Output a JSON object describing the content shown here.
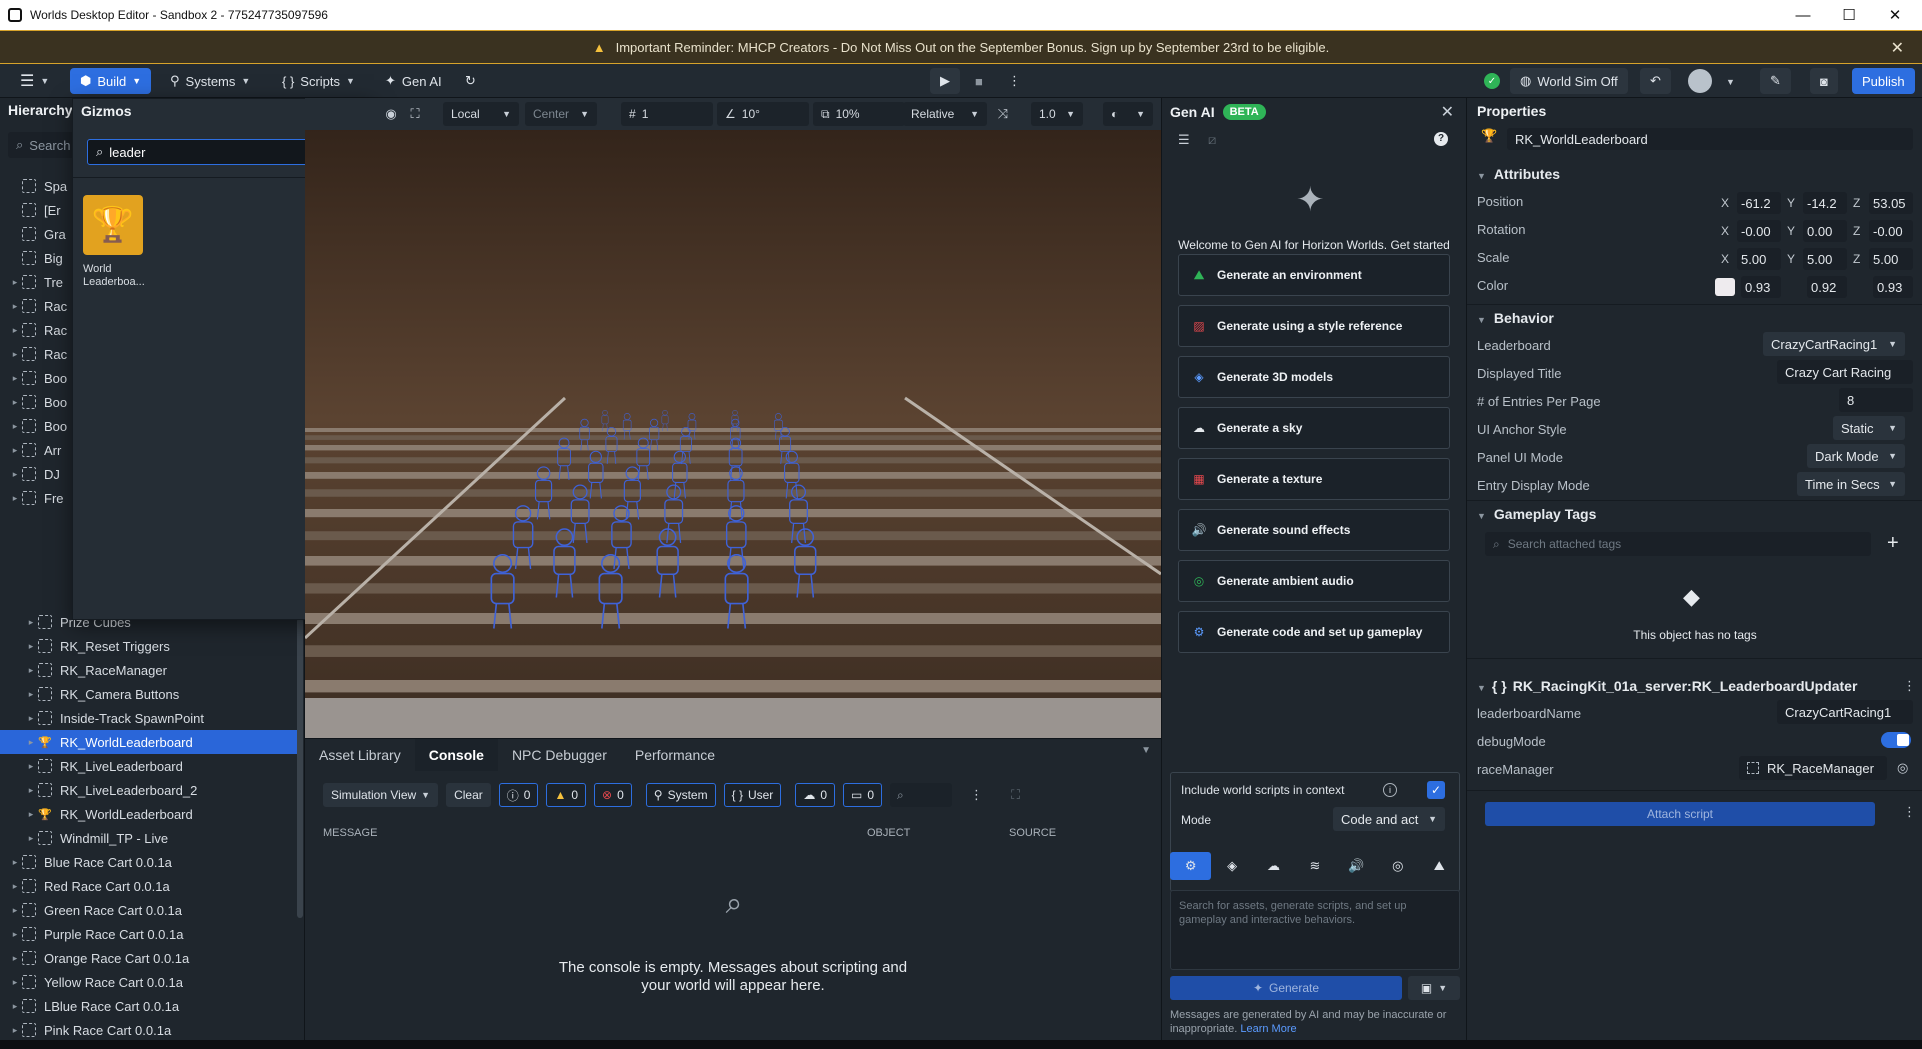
{
  "window": {
    "title": "Worlds Desktop Editor - Sandbox 2 - 775247735097596",
    "minimize": "—",
    "maximize": "☐",
    "close": "✕"
  },
  "banner": {
    "text": "Important Reminder: MHCP Creators - Do Not Miss Out on the September Bonus. Sign up by September 23rd to be eligible.",
    "close": "✕"
  },
  "toolbar": {
    "build": "Build",
    "systems": "Systems",
    "scripts": "Scripts",
    "genai": "Gen AI",
    "world_sim": "World Sim Off",
    "publish": "Publish"
  },
  "hierarchy": {
    "title": "Hierarchy",
    "search_placeholder": "Search",
    "partial_items": [
      "Spa",
      "[Er",
      "Gra",
      "Big",
      "Tre",
      "Rac",
      "Rac",
      "Rac",
      "Boo",
      "Boo",
      "Boo",
      "Arr",
      "DJ",
      "Fre"
    ],
    "items": [
      {
        "label": "Prize Cubes",
        "indent": 1
      },
      {
        "label": "RK_Reset Triggers",
        "indent": 1
      },
      {
        "label": "RK_RaceManager",
        "indent": 1
      },
      {
        "label": "RK_Camera Buttons",
        "indent": 1
      },
      {
        "label": "Inside-Track SpawnPoint",
        "indent": 1
      },
      {
        "label": "RK_WorldLeaderboard",
        "indent": 1,
        "selected": true
      },
      {
        "label": "RK_LiveLeaderboard",
        "indent": 1
      },
      {
        "label": "RK_LiveLeaderboard_2",
        "indent": 1
      },
      {
        "label": "RK_WorldLeaderboard",
        "indent": 1
      },
      {
        "label": "Windmill_TP - Live",
        "indent": 1
      },
      {
        "label": "Blue Race Cart 0.0.1a",
        "indent": 0
      },
      {
        "label": "Red Race Cart 0.0.1a",
        "indent": 0
      },
      {
        "label": "Green Race Cart 0.0.1a",
        "indent": 0
      },
      {
        "label": "Purple Race Cart 0.0.1a",
        "indent": 0
      },
      {
        "label": "Orange Race Cart 0.0.1a",
        "indent": 0
      },
      {
        "label": "Yellow Race Cart 0.0.1a",
        "indent": 0
      },
      {
        "label": "LBlue Race Cart 0.0.1a",
        "indent": 0
      },
      {
        "label": "Pink Race Cart 0.0.1a",
        "indent": 0
      }
    ]
  },
  "gizmos": {
    "title": "Gizmos",
    "search_value": "leader",
    "result_label": "World Leaderboa..."
  },
  "viewport_toolbar": {
    "space": "Local",
    "pivot": "Center",
    "grid": "1",
    "angle": "10°",
    "scale": "10%",
    "mode": "Relative",
    "speed": "1.0"
  },
  "bottom": {
    "tabs": [
      "Asset Library",
      "Console",
      "NPC Debugger",
      "Performance"
    ],
    "active_tab": "Console",
    "sim_view": "Simulation View",
    "clear": "Clear",
    "info_count": "0",
    "warn_count": "0",
    "error_count": "0",
    "system": "System",
    "user": "User",
    "cloud_count": "0",
    "local_count": "0",
    "col_message": "MESSAGE",
    "col_object": "OBJECT",
    "col_source": "SOURCE",
    "empty_text": "The console is empty. Messages about scripting and your world will appear here."
  },
  "genai": {
    "title": "Gen AI",
    "beta": "BETA",
    "welcome": "Welcome to Gen AI for Horizon Worlds. Get started by trying a sample prompt or writing your own.",
    "buttons": [
      "Generate an environment",
      "Generate using a style reference",
      "Generate 3D models",
      "Generate a sky",
      "Generate a texture",
      "Generate sound effects",
      "Generate ambient audio",
      "Generate code and set up gameplay"
    ],
    "include_scripts": "Include world scripts in context",
    "mode_label": "Mode",
    "mode_value": "Code and act",
    "prompt_placeholder": "Search for assets, generate scripts, and set up gameplay and interactive behaviors.",
    "generate": "Generate",
    "disclaimer": "Messages are generated by AI and may be inaccurate or inappropriate.",
    "learn_more": "Learn More"
  },
  "properties": {
    "title": "Properties",
    "object_name": "RK_WorldLeaderboard",
    "attributes_title": "Attributes",
    "position": {
      "label": "Position",
      "x": "-61.2",
      "y": "-14.2",
      "z": "53.05"
    },
    "rotation": {
      "label": "Rotation",
      "x": "-0.00",
      "y": "0.00",
      "z": "-0.00"
    },
    "scale": {
      "label": "Scale",
      "x": "5.00",
      "y": "5.00",
      "z": "5.00"
    },
    "color": {
      "label": "Color",
      "r": "0.93",
      "g": "0.92",
      "b": "0.93"
    },
    "behavior_title": "Behavior",
    "leaderboard": {
      "label": "Leaderboard",
      "value": "CrazyCartRacing1"
    },
    "displayed_title": {
      "label": "Displayed Title",
      "value": "Crazy Cart Racing"
    },
    "entries": {
      "label": "# of Entries Per Page",
      "value": "8"
    },
    "anchor": {
      "label": "UI Anchor Style",
      "value": "Static"
    },
    "panel_mode": {
      "label": "Panel UI Mode",
      "value": "Dark Mode"
    },
    "entry_mode": {
      "label": "Entry Display Mode",
      "value": "Time in Secs"
    },
    "tags_title": "Gameplay Tags",
    "tags_placeholder": "Search attached tags",
    "no_tags": "This object has no tags",
    "script_title": "RK_RacingKit_01a_server:RK_LeaderboardUpdater",
    "lb_name": {
      "label": "leaderboardName",
      "value": "CrazyCartRacing1"
    },
    "debug": {
      "label": "debugMode"
    },
    "race_manager": {
      "label": "raceManager",
      "value": "RK_RaceManager"
    },
    "attach": "Attach script"
  },
  "colors": {
    "accent": "#2d6ee0",
    "banner_border": "#d7a32b",
    "selected": "#2a66d9"
  }
}
